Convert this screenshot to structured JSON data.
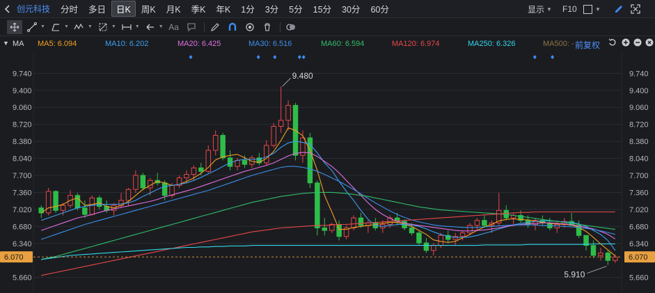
{
  "header": {
    "stock_name": "创元科技",
    "periods": [
      {
        "label": "分时",
        "active": false
      },
      {
        "label": "多日",
        "active": false
      },
      {
        "label": "日K",
        "active": true
      },
      {
        "label": "周K",
        "active": false
      },
      {
        "label": "月K",
        "active": false
      },
      {
        "label": "季K",
        "active": false
      },
      {
        "label": "年K",
        "active": false
      },
      {
        "label": "1分",
        "active": false
      },
      {
        "label": "3分",
        "active": false
      },
      {
        "label": "5分",
        "active": false
      },
      {
        "label": "15分",
        "active": false
      },
      {
        "label": "30分",
        "active": false
      },
      {
        "label": "60分",
        "active": false
      }
    ],
    "display_label": "显示",
    "f10_label": "F10"
  },
  "toolbar": {
    "text_tool_label": "Aa",
    "icons": [
      "move-icon",
      "line-tool-icon",
      "polyline-tool-icon",
      "wave-tool-icon",
      "fib-tool-icon",
      "range-tool-icon",
      "arrow-tool-icon",
      "text-tool-icon",
      "comment-icon",
      "pen-icon",
      "magnet-icon",
      "eye-icon",
      "trash-icon",
      "toggle-icon"
    ]
  },
  "ma_bar": {
    "indicator": "MA",
    "items": [
      {
        "label": "MA5: 6.094",
        "color": "#f0a020"
      },
      {
        "label": "MA10: 6.202",
        "color": "#3ba0f0"
      },
      {
        "label": "MA20: 6.425",
        "color": "#e070e0"
      },
      {
        "label": "MA30: 6.516",
        "color": "#3c8ee8"
      },
      {
        "label": "MA60: 6.594",
        "color": "#2fbd6a"
      },
      {
        "label": "MA120: 6.974",
        "color": "#e84848"
      },
      {
        "label": "MA250: 6.326",
        "color": "#30d8e8"
      },
      {
        "label": "MA500: -",
        "color": "#8a7444"
      }
    ],
    "adjust_label": "前复权"
  },
  "chart_data": {
    "type": "candlestick",
    "y_ticks": [
      "9.740",
      "9.400",
      "9.060",
      "8.720",
      "8.380",
      "8.040",
      "7.700",
      "7.360",
      "7.020",
      "6.680",
      "6.340",
      "6.000",
      "5.660"
    ],
    "ylim": [
      5.53,
      9.87
    ],
    "current_price": "6.070",
    "max_label": "9.480",
    "min_label": "5.910",
    "up_color": "#e84848",
    "down_color": "#2fbd4a",
    "candles": [
      [
        7.05,
        7.1,
        6.85,
        6.95
      ],
      [
        6.95,
        7.45,
        6.9,
        7.38
      ],
      [
        7.38,
        7.4,
        6.95,
        7.0
      ],
      [
        7.0,
        7.15,
        6.9,
        7.1
      ],
      [
        7.1,
        7.4,
        7.05,
        7.3
      ],
      [
        7.3,
        7.35,
        7.0,
        7.05
      ],
      [
        7.05,
        7.2,
        6.85,
        6.92
      ],
      [
        6.92,
        7.3,
        6.9,
        7.25
      ],
      [
        7.25,
        7.3,
        7.02,
        7.08
      ],
      [
        7.08,
        7.2,
        6.95,
        7.0
      ],
      [
        7.0,
        7.15,
        6.9,
        7.1
      ],
      [
        7.1,
        7.35,
        7.05,
        7.2
      ],
      [
        7.2,
        7.45,
        7.1,
        7.42
      ],
      [
        7.42,
        7.8,
        7.35,
        7.7
      ],
      [
        7.7,
        7.75,
        7.4,
        7.45
      ],
      [
        7.45,
        7.65,
        7.3,
        7.6
      ],
      [
        7.6,
        7.75,
        7.5,
        7.55
      ],
      [
        7.55,
        7.6,
        7.2,
        7.3
      ],
      [
        7.3,
        7.55,
        7.25,
        7.5
      ],
      [
        7.5,
        7.7,
        7.45,
        7.65
      ],
      [
        7.65,
        7.8,
        7.55,
        7.72
      ],
      [
        7.72,
        7.9,
        7.6,
        7.85
      ],
      [
        7.85,
        7.95,
        7.7,
        7.78
      ],
      [
        7.78,
        8.3,
        7.75,
        8.2
      ],
      [
        8.2,
        8.6,
        8.1,
        8.5
      ],
      [
        8.5,
        8.55,
        8.0,
        8.05
      ],
      [
        8.05,
        8.2,
        7.8,
        7.88
      ],
      [
        7.88,
        8.05,
        7.8,
        8.0
      ],
      [
        8.0,
        8.1,
        7.85,
        7.92
      ],
      [
        7.92,
        8.1,
        7.85,
        8.05
      ],
      [
        8.05,
        8.15,
        7.9,
        7.95
      ],
      [
        7.95,
        8.4,
        7.9,
        8.3
      ],
      [
        8.3,
        8.75,
        8.25,
        8.68
      ],
      [
        8.68,
        9.48,
        8.55,
        8.8
      ],
      [
        8.8,
        9.2,
        8.6,
        9.1
      ],
      [
        9.1,
        9.15,
        8.0,
        8.1
      ],
      [
        8.1,
        8.6,
        7.95,
        8.45
      ],
      [
        8.45,
        8.55,
        7.45,
        7.55
      ],
      [
        7.55,
        7.6,
        6.5,
        6.65
      ],
      [
        6.65,
        6.85,
        6.5,
        6.6
      ],
      [
        6.6,
        6.75,
        6.55,
        6.72
      ],
      [
        6.72,
        6.8,
        6.4,
        6.48
      ],
      [
        6.48,
        6.7,
        6.42,
        6.65
      ],
      [
        6.65,
        6.9,
        6.6,
        6.85
      ],
      [
        6.85,
        6.95,
        6.65,
        6.7
      ],
      [
        6.7,
        6.8,
        6.55,
        6.75
      ],
      [
        6.75,
        6.85,
        6.6,
        6.65
      ],
      [
        6.65,
        6.8,
        6.55,
        6.72
      ],
      [
        6.72,
        6.9,
        6.65,
        6.85
      ],
      [
        6.85,
        6.95,
        6.7,
        6.78
      ],
      [
        6.78,
        6.82,
        6.6,
        6.65
      ],
      [
        6.65,
        6.75,
        6.5,
        6.55
      ],
      [
        6.55,
        6.6,
        6.3,
        6.35
      ],
      [
        6.35,
        6.45,
        6.15,
        6.2
      ],
      [
        6.2,
        6.35,
        6.1,
        6.3
      ],
      [
        6.3,
        6.55,
        6.25,
        6.5
      ],
      [
        6.5,
        6.6,
        6.35,
        6.42
      ],
      [
        6.42,
        6.55,
        6.3,
        6.48
      ],
      [
        6.48,
        6.6,
        6.4,
        6.55
      ],
      [
        6.55,
        6.75,
        6.5,
        6.7
      ],
      [
        6.7,
        6.85,
        6.6,
        6.8
      ],
      [
        6.8,
        6.9,
        6.65,
        6.7
      ],
      [
        6.7,
        6.8,
        6.55,
        6.75
      ],
      [
        6.75,
        7.35,
        6.7,
        7.0
      ],
      [
        7.0,
        7.1,
        6.8,
        6.85
      ],
      [
        6.85,
        6.95,
        6.7,
        6.9
      ],
      [
        6.9,
        7.0,
        6.75,
        6.8
      ],
      [
        6.8,
        6.9,
        6.65,
        6.72
      ],
      [
        6.72,
        6.85,
        6.6,
        6.8
      ],
      [
        6.8,
        6.9,
        6.7,
        6.75
      ],
      [
        6.75,
        6.85,
        6.6,
        6.65
      ],
      [
        6.65,
        6.8,
        6.55,
        6.72
      ],
      [
        6.72,
        6.85,
        6.65,
        6.78
      ],
      [
        6.78,
        6.95,
        6.7,
        6.7
      ],
      [
        6.7,
        6.8,
        6.45,
        6.5
      ],
      [
        6.5,
        6.3,
        6.2,
        6.3
      ],
      [
        6.3,
        6.4,
        6.05,
        6.1
      ],
      [
        6.1,
        6.25,
        6.0,
        6.15
      ],
      [
        6.15,
        6.2,
        5.91,
        6.0
      ],
      [
        6.0,
        6.12,
        5.95,
        6.07
      ]
    ],
    "ma_lines": {
      "MA5": [
        6.95,
        7.05,
        7.08,
        7.12,
        7.2,
        7.25,
        7.1,
        7.12,
        7.15,
        7.08,
        7.05,
        7.1,
        7.18,
        7.3,
        7.42,
        7.5,
        7.58,
        7.55,
        7.5,
        7.52,
        7.58,
        7.65,
        7.74,
        7.86,
        8.01,
        8.07,
        8.1,
        8.12,
        8.05,
        7.98,
        7.96,
        8.04,
        8.18,
        8.4,
        8.65,
        8.6,
        8.49,
        8.2,
        7.8,
        7.3,
        6.97,
        6.62,
        6.62,
        6.66,
        6.68,
        6.7,
        6.72,
        6.74,
        6.76,
        6.76,
        6.72,
        6.68,
        6.6,
        6.52,
        6.41,
        6.38,
        6.36,
        6.38,
        6.45,
        6.52,
        6.6,
        6.67,
        6.72,
        6.79,
        6.82,
        6.83,
        6.82,
        6.81,
        6.79,
        6.76,
        6.74,
        6.73,
        6.72,
        6.71,
        6.66,
        6.58,
        6.46,
        6.33,
        6.21,
        6.09
      ],
      "MA10": [
        6.8,
        6.85,
        6.9,
        6.95,
        7.0,
        7.05,
        7.08,
        7.1,
        7.12,
        7.12,
        7.12,
        7.13,
        7.15,
        7.2,
        7.28,
        7.35,
        7.42,
        7.48,
        7.5,
        7.52,
        7.55,
        7.6,
        7.66,
        7.73,
        7.8,
        7.88,
        7.95,
        8.0,
        8.02,
        8.02,
        8.02,
        8.07,
        8.14,
        8.26,
        8.35,
        8.38,
        8.36,
        8.32,
        8.15,
        7.95,
        7.8,
        7.58,
        7.38,
        7.2,
        7.0,
        6.82,
        6.7,
        6.68,
        6.7,
        6.72,
        6.72,
        6.71,
        6.68,
        6.63,
        6.57,
        6.52,
        6.48,
        6.46,
        6.46,
        6.47,
        6.5,
        6.54,
        6.58,
        6.63,
        6.67,
        6.71,
        6.74,
        6.76,
        6.78,
        6.79,
        6.79,
        6.78,
        6.77,
        6.76,
        6.73,
        6.68,
        6.6,
        6.52,
        6.4,
        6.2
      ],
      "MA20": [
        6.6,
        6.65,
        6.7,
        6.75,
        6.8,
        6.85,
        6.88,
        6.92,
        6.96,
        7.0,
        7.03,
        7.06,
        7.09,
        7.12,
        7.15,
        7.18,
        7.22,
        7.27,
        7.31,
        7.35,
        7.39,
        7.43,
        7.48,
        7.53,
        7.58,
        7.63,
        7.68,
        7.73,
        7.78,
        7.82,
        7.86,
        7.9,
        7.95,
        8.02,
        8.09,
        8.14,
        8.16,
        8.15,
        8.08,
        7.98,
        7.88,
        7.75,
        7.6,
        7.45,
        7.3,
        7.15,
        7.02,
        6.92,
        6.84,
        6.78,
        6.75,
        6.72,
        6.7,
        6.68,
        6.66,
        6.64,
        6.62,
        6.6,
        6.59,
        6.59,
        6.6,
        6.61,
        6.63,
        6.65,
        6.68,
        6.7,
        6.72,
        6.73,
        6.74,
        6.75,
        6.75,
        6.74,
        6.73,
        6.71,
        6.69,
        6.66,
        6.63,
        6.58,
        6.52,
        6.43
      ],
      "MA30": [
        6.42,
        6.47,
        6.52,
        6.57,
        6.62,
        6.67,
        6.72,
        6.76,
        6.8,
        6.84,
        6.88,
        6.92,
        6.96,
        7.0,
        7.04,
        7.08,
        7.12,
        7.16,
        7.2,
        7.24,
        7.28,
        7.32,
        7.36,
        7.4,
        7.45,
        7.5,
        7.55,
        7.6,
        7.65,
        7.7,
        7.74,
        7.78,
        7.82,
        7.86,
        7.88,
        7.88,
        7.86,
        7.83,
        7.78,
        7.72,
        7.65,
        7.58,
        7.5,
        7.42,
        7.33,
        7.24,
        7.15,
        7.07,
        6.99,
        6.92,
        6.86,
        6.81,
        6.77,
        6.74,
        6.71,
        6.69,
        6.68,
        6.67,
        6.66,
        6.66,
        6.66,
        6.67,
        6.68,
        6.69,
        6.7,
        6.71,
        6.71,
        6.71,
        6.71,
        6.7,
        6.7,
        6.69,
        6.68,
        6.67,
        6.66,
        6.64,
        6.62,
        6.59,
        6.56,
        6.52
      ],
      "MA60": [
        6.02,
        6.05,
        6.08,
        6.12,
        6.16,
        6.2,
        6.24,
        6.28,
        6.32,
        6.36,
        6.4,
        6.44,
        6.48,
        6.52,
        6.56,
        6.6,
        6.64,
        6.68,
        6.72,
        6.76,
        6.8,
        6.84,
        6.88,
        6.92,
        6.96,
        7.0,
        7.04,
        7.08,
        7.12,
        7.16,
        7.19,
        7.22,
        7.25,
        7.28,
        7.3,
        7.32,
        7.34,
        7.35,
        7.36,
        7.36,
        7.36,
        7.35,
        7.34,
        7.32,
        7.3,
        7.28,
        7.25,
        7.22,
        7.19,
        7.16,
        7.13,
        7.1,
        7.07,
        7.05,
        7.03,
        7.01,
        7.0,
        6.99,
        6.98,
        6.97,
        6.96,
        6.95,
        6.94,
        6.93,
        6.92,
        6.9,
        6.88,
        6.86,
        6.84,
        6.82,
        6.8,
        6.78,
        6.76,
        6.74,
        6.72,
        6.7,
        6.68,
        6.66,
        6.64,
        6.62
      ],
      "MA120": [
        5.7,
        5.73,
        5.76,
        5.79,
        5.82,
        5.85,
        5.88,
        5.91,
        5.94,
        5.97,
        6.0,
        6.03,
        6.06,
        6.09,
        6.12,
        6.15,
        6.18,
        6.21,
        6.24,
        6.27,
        6.3,
        6.33,
        6.36,
        6.39,
        6.42,
        6.45,
        6.48,
        6.51,
        6.54,
        6.57,
        6.59,
        6.61,
        6.63,
        6.65,
        6.66,
        6.67,
        6.68,
        6.69,
        6.7,
        6.7,
        6.71,
        6.72,
        6.72,
        6.73,
        6.74,
        6.75,
        6.76,
        6.77,
        6.78,
        6.79,
        6.8,
        6.81,
        6.82,
        6.83,
        6.84,
        6.85,
        6.86,
        6.87,
        6.88,
        6.89,
        6.9,
        6.91,
        6.92,
        6.93,
        6.94,
        6.95,
        6.96,
        6.96,
        6.97,
        6.97,
        6.97,
        6.97,
        6.97,
        6.97,
        6.97,
        6.97,
        6.97,
        6.97,
        6.97,
        6.97
      ],
      "MA250": [
        6.02,
        6.04,
        6.06,
        6.08,
        6.1,
        6.11,
        6.12,
        6.13,
        6.14,
        6.15,
        6.16,
        6.17,
        6.18,
        6.19,
        6.2,
        6.21,
        6.22,
        6.23,
        6.24,
        6.25,
        6.26,
        6.26,
        6.27,
        6.27,
        6.28,
        6.28,
        6.29,
        6.29,
        6.29,
        6.3,
        6.3,
        6.3,
        6.3,
        6.3,
        6.3,
        6.3,
        6.3,
        6.3,
        6.3,
        6.3,
        6.3,
        6.3,
        6.3,
        6.3,
        6.3,
        6.3,
        6.3,
        6.3,
        6.3,
        6.3,
        6.3,
        6.3,
        6.3,
        6.3,
        6.3,
        6.3,
        6.3,
        6.3,
        6.3,
        6.3,
        6.3,
        6.31,
        6.31,
        6.31,
        6.31,
        6.31,
        6.31,
        6.32,
        6.32,
        6.32,
        6.32,
        6.32,
        6.32,
        6.32,
        6.32,
        6.32,
        6.33,
        6.33,
        6.33,
        6.33
      ]
    },
    "markers": [
      0.155,
      0.27,
      0.298,
      0.34,
      0.347,
      0.74,
      0.77
    ]
  }
}
